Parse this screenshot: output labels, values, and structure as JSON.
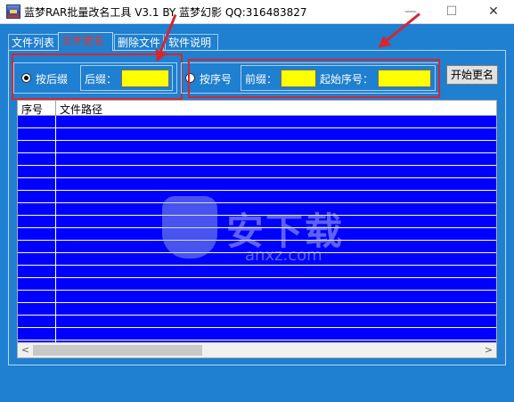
{
  "window": {
    "title": "蓝梦RAR批量改名工具 V3.1 BY 蓝梦幻影 QQ:316483827",
    "minimize_glyph": "—",
    "maximize_glyph": "☐",
    "close_glyph": "✕"
  },
  "tabs": [
    {
      "label": "文件列表",
      "active": false
    },
    {
      "label": "文件更名",
      "active": true
    },
    {
      "label": "删除文件",
      "active": false
    },
    {
      "label": "软件说明",
      "active": false
    }
  ],
  "suffix_group": {
    "radio_label": "按后缀",
    "checked": true,
    "field_label": "后缀：",
    "field_value": ""
  },
  "sequence_group": {
    "radio_label": "按序号",
    "checked": false,
    "prefix_label": "前缀：",
    "prefix_value": "",
    "start_label": "起始序号：",
    "start_value": ""
  },
  "start_button": {
    "label": "开始更名"
  },
  "table": {
    "columns": [
      "序号",
      "文件路径"
    ],
    "rows": []
  },
  "scrollbar": {
    "left_glyph": "<",
    "right_glyph": ">"
  },
  "watermark": {
    "text": "安下载",
    "domain": "anxz.com"
  },
  "colors": {
    "client_bg": "#1f7fd0",
    "table_bg": "#0000ff",
    "input_bg": "#ffff00",
    "annotation_red": "#d7262e",
    "active_tab_text": "#e6362b"
  }
}
